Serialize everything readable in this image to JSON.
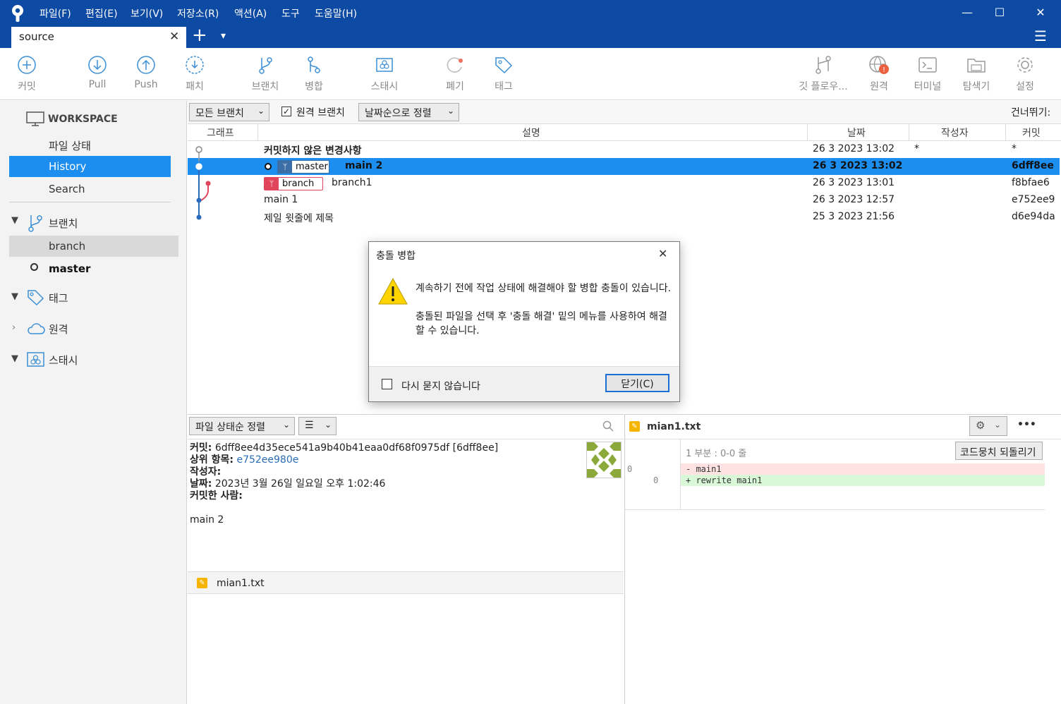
{
  "window": {
    "menus": [
      "파일(F)",
      "편집(E)",
      "보기(V)",
      "저장소(R)",
      "액션(A)",
      "도구",
      "도움말(H)"
    ],
    "controls": {
      "minimize": "—",
      "maximize": "☐",
      "close": "✕"
    }
  },
  "tabs": {
    "active_tab": "source",
    "close": "✕",
    "add": "+",
    "dropdown": "▾",
    "menu": "☰"
  },
  "toolbar": {
    "commit": "커밋",
    "pull": "Pull",
    "push": "Push",
    "patch": "패치",
    "branch": "브랜치",
    "merge": "병합",
    "stash": "스태시",
    "discard": "폐기",
    "tag": "태그",
    "gitflow": "깃 플로우...",
    "remote": "원격",
    "terminal": "터미널",
    "explorer": "탐색기",
    "settings": "설정"
  },
  "sidebar": {
    "workspace": "WORKSPACE",
    "file_status": "파일 상태",
    "history": "History",
    "search": "Search",
    "branches_header": "브랜치",
    "branches": [
      "branch",
      "master"
    ],
    "tags_header": "태그",
    "remotes_header": "원격",
    "stash_header": "스태시"
  },
  "filters": {
    "all_branches": "모든 브랜치",
    "remote_branches": "원격 브랜치",
    "sort": "날짜순으로 정렬",
    "jump": "건너뛰기:"
  },
  "grid": {
    "columns": [
      "그래프",
      "설명",
      "날짜",
      "작성자",
      "커밋"
    ],
    "rows": [
      {
        "desc": "커밋하지 않은 변경사항",
        "date": "26 3 2023 13:02",
        "author": "*",
        "commit": "*"
      },
      {
        "tag": "master",
        "desc": "main 2",
        "date": "26 3 2023 13:02",
        "author": "",
        "commit": "6dff8ee"
      },
      {
        "tag": "branch",
        "desc": "branch1",
        "date": "26 3 2023 13:01",
        "author": "",
        "commit": "f8bfae6"
      },
      {
        "desc": "main 1",
        "date": "26 3 2023 12:57",
        "author": "",
        "commit": "e752ee9"
      },
      {
        "desc": "제일 윗줄에 제목",
        "date": "25 3 2023 21:56",
        "author": "",
        "commit": "d6e94da"
      }
    ]
  },
  "dialog": {
    "title": "충돌 병합",
    "message1": "계속하기 전에 작업 상태에 해결해야 할 병합 충돌이 있습니다.",
    "message2": "충돌된 파일을 선택 후 '충돌 해결' 밑의 메뉴를 사용하여 해결할 수 있습니다.",
    "dont_ask": "다시 묻지 않습니다",
    "close_button": "닫기(C)",
    "close_x": "✕"
  },
  "details": {
    "sort_button": "파일 상태순 정렬",
    "view_button": "☰",
    "commit_label": "커밋:",
    "commit_value": "6dff8ee4d35ece541a9b40b41eaa0df68f0975df [6dff8ee]",
    "parent_label": "상위 항목:",
    "parent_value": "e752ee980e",
    "author_label": "작성자:",
    "date_label": "날짜:",
    "date_value": "2023년 3월 26일 일요일 오후 1:02:46",
    "committer_label": "커밋한 사람:",
    "message": "main 2",
    "file": "mian1.txt"
  },
  "diff": {
    "file": "mian1.txt",
    "hunk_header": "1 부분 : 0-0 줄",
    "revert_button": "코드뭉치 되돌리기",
    "more": "•••",
    "lines": [
      {
        "old": "0",
        "new": "",
        "text": "- main1",
        "type": "del"
      },
      {
        "old": "",
        "new": "0",
        "text": "+ rewrite main1",
        "type": "add"
      }
    ]
  },
  "colors": {
    "accent": "#0d4aa3",
    "selection": "#1c8ef0",
    "master_tag": "#3a6ea5",
    "branch_tag": "#e0455b",
    "graph_blue": "#2e6bbd",
    "graph_red": "#e0455b"
  }
}
